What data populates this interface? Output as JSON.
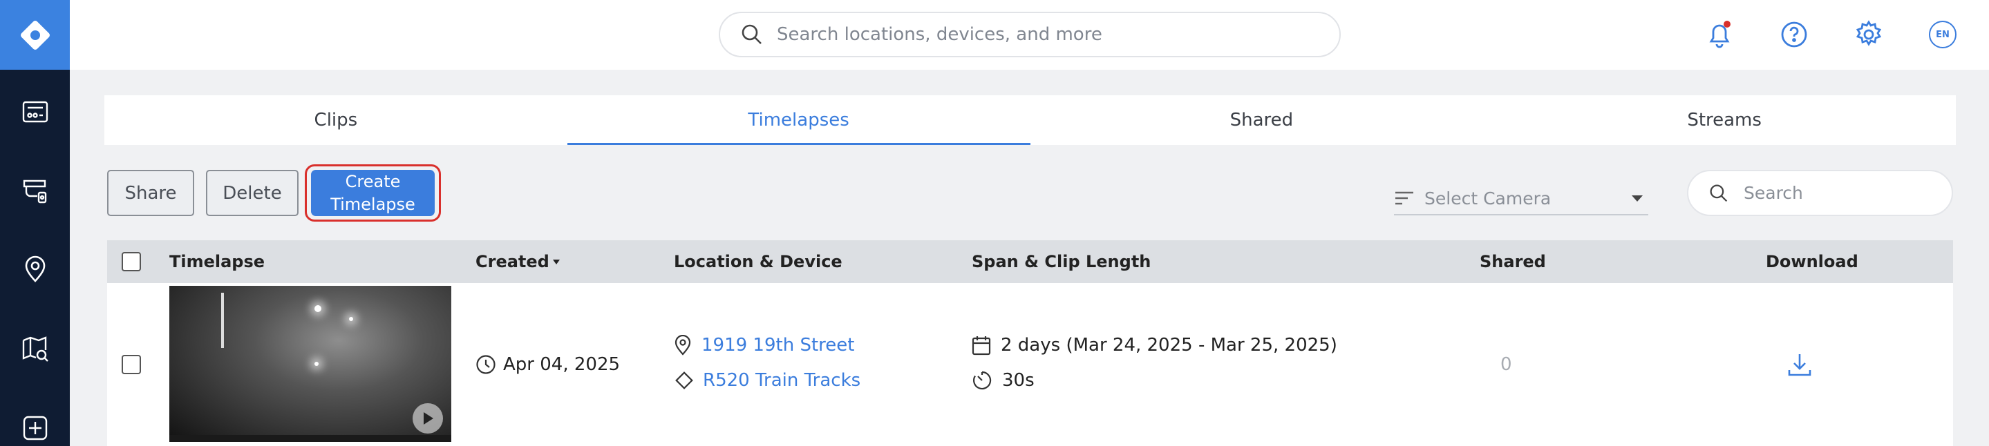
{
  "header": {
    "search_placeholder": "Search locations, devices, and more",
    "language": "EN"
  },
  "tabs": [
    {
      "label": "Clips",
      "active": false
    },
    {
      "label": "Timelapses",
      "active": true
    },
    {
      "label": "Shared",
      "active": false
    },
    {
      "label": "Streams",
      "active": false
    }
  ],
  "toolbar": {
    "share_label": "Share",
    "delete_label": "Delete",
    "create_label": "Create Timelapse",
    "camera_select_placeholder": "Select Camera",
    "search_placeholder": "Search"
  },
  "table": {
    "columns": {
      "timelapse": "Timelapse",
      "created": "Created",
      "location_device": "Location & Device",
      "span_clip": "Span & Clip Length",
      "shared": "Shared",
      "download": "Download"
    },
    "rows": [
      {
        "created": "Apr 04, 2025",
        "location": "1919 19th Street",
        "device": "R520 Train Tracks",
        "span": "2 days (Mar 24, 2025 - Mar 25, 2025)",
        "clip_length": "30s",
        "shared": "0"
      }
    ]
  },
  "colors": {
    "accent": "#3b7ddd",
    "sidebar": "#0f1c33",
    "highlight": "#d9302c",
    "notification_dot": "#d9302c"
  }
}
